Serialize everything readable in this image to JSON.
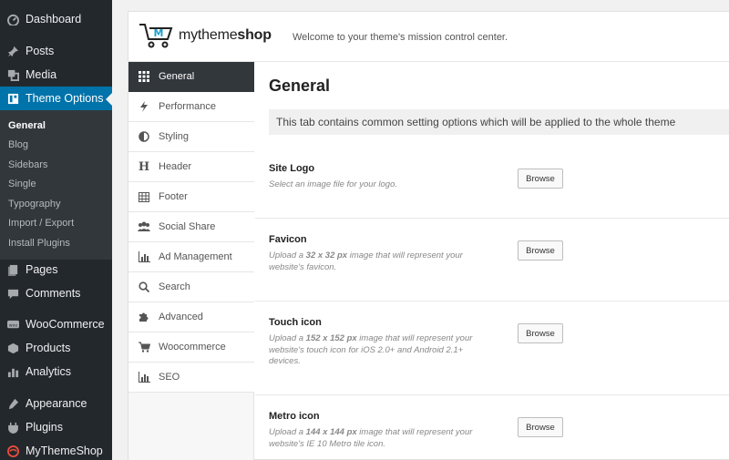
{
  "sidebar": {
    "items": [
      {
        "label": "Dashboard",
        "icon": "dashboard-icon"
      },
      {
        "label": "Posts",
        "icon": "pin-icon"
      },
      {
        "label": "Media",
        "icon": "media-icon"
      },
      {
        "label": "Theme Options",
        "icon": "theme-options-icon"
      },
      {
        "label": "Pages",
        "icon": "pages-icon"
      },
      {
        "label": "Comments",
        "icon": "comments-icon"
      },
      {
        "label": "WooCommerce",
        "icon": "woocommerce-icon"
      },
      {
        "label": "Products",
        "icon": "products-icon"
      },
      {
        "label": "Analytics",
        "icon": "analytics-icon"
      },
      {
        "label": "Appearance",
        "icon": "appearance-icon"
      },
      {
        "label": "Plugins",
        "icon": "plugins-icon"
      },
      {
        "label": "MyThemeShop",
        "icon": "mythemeshop-icon"
      }
    ],
    "submenu": [
      "General",
      "Blog",
      "Sidebars",
      "Single",
      "Typography",
      "Import / Export",
      "Install Plugins"
    ],
    "active_color": "#0073aa"
  },
  "header": {
    "logo_prefix": "mytheme",
    "logo_suffix": "shop",
    "welcome": "Welcome to your theme's mission control center."
  },
  "tabs": [
    {
      "label": "General",
      "icon": "grid-icon"
    },
    {
      "label": "Performance",
      "icon": "bolt-icon"
    },
    {
      "label": "Styling",
      "icon": "contrast-icon"
    },
    {
      "label": "Header",
      "icon": "header-icon"
    },
    {
      "label": "Footer",
      "icon": "table-icon"
    },
    {
      "label": "Social Share",
      "icon": "users-icon"
    },
    {
      "label": "Ad Management",
      "icon": "bar-chart-icon"
    },
    {
      "label": "Search",
      "icon": "search-icon"
    },
    {
      "label": "Advanced",
      "icon": "puzzle-icon"
    },
    {
      "label": "Woocommerce",
      "icon": "cart-icon"
    },
    {
      "label": "SEO",
      "icon": "bar-chart-icon"
    }
  ],
  "content": {
    "title": "General",
    "description": "This tab contains common setting options which will be applied to the whole theme",
    "browse_label": "Browse",
    "options": [
      {
        "title": "Site Logo",
        "desc_pre": "Select an image file for your logo.",
        "desc_bold": "",
        "desc_post": ""
      },
      {
        "title": "Favicon",
        "desc_pre": "Upload a ",
        "desc_bold": "32 x 32 px",
        "desc_post": " image that will represent your website's favicon."
      },
      {
        "title": "Touch icon",
        "desc_pre": "Upload a ",
        "desc_bold": "152 x 152 px",
        "desc_post": " image that will represent your website's touch icon for iOS 2.0+ and Android 2.1+ devices."
      },
      {
        "title": "Metro icon",
        "desc_pre": "Upload a ",
        "desc_bold": "144 x 144 px",
        "desc_post": " image that will represent your website's IE 10 Metro tile icon."
      }
    ]
  }
}
